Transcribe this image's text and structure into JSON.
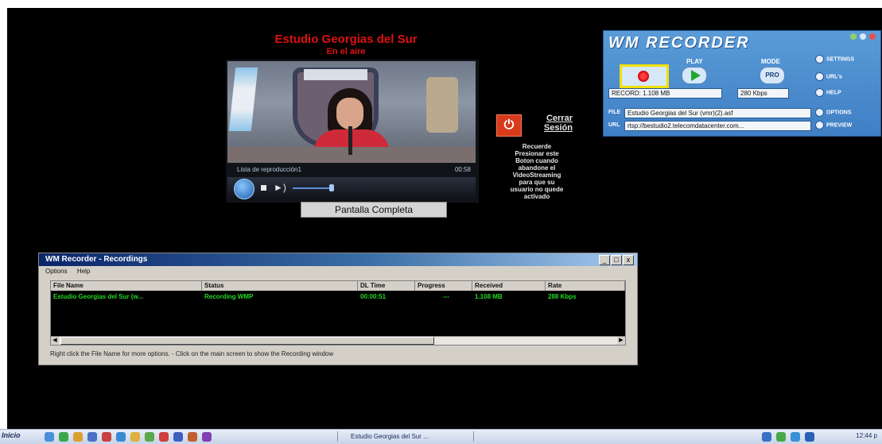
{
  "stream": {
    "title": "Estudio Georgias del Sur",
    "subtitle": "En el aire",
    "playlist_label": "Lista de reproducción1",
    "time": "00:58",
    "fullscreen_label": "Pantalla Completa"
  },
  "session": {
    "close_label_line1": "Cerrar",
    "close_label_line2": "Sesión",
    "note": "Recuerde\nPresionar este\nBoton cuando\nabandone el\nVideoStreaming\npara que su\nusuario no quede\nactivado"
  },
  "recorder": {
    "logo": "WM RECORDER",
    "labels": {
      "play": "PLAY",
      "mode": "MODE"
    },
    "mode_value": "PRO",
    "record_status": "RECORD: 1.108 MB",
    "bitrate": "280 Kbps",
    "file_label": "FILE",
    "file_value": "Estudio Georgias del Sur (vmr)(2).asf",
    "url_label": "URL",
    "url_value": "rtsp://bestudio2.telecomdatacenter.com...",
    "side": {
      "settings": "SETTINGS",
      "url": "URL's",
      "help": "HELP",
      "options": "OPTIONS",
      "preview": "PREVIEW"
    }
  },
  "recordings_window": {
    "title": "WM Recorder - Recordings",
    "menu": [
      "Options",
      "Help"
    ],
    "columns": [
      "File Name",
      "Status",
      "DL Time",
      "Progress",
      "Received",
      "Rate"
    ],
    "rows": [
      [
        "Estudio Georgias del Sur (w...",
        "Recording WMP",
        "00:00:51",
        "---",
        "1.108 MB",
        "288 Kbps"
      ]
    ],
    "status_text": "Right click the File Name for more options. - Click on the main screen to show the Recording window"
  },
  "taskbar": {
    "start": "Inicio",
    "task": "Estudio Georgias del Sur ...",
    "clock": "12:44 p"
  },
  "colors": {
    "background": "#000000",
    "title_red": "#e01010",
    "recorder_blue": "#4a8cd0",
    "record_highlight": "#f0e000",
    "list_text_green": "#22d822"
  }
}
